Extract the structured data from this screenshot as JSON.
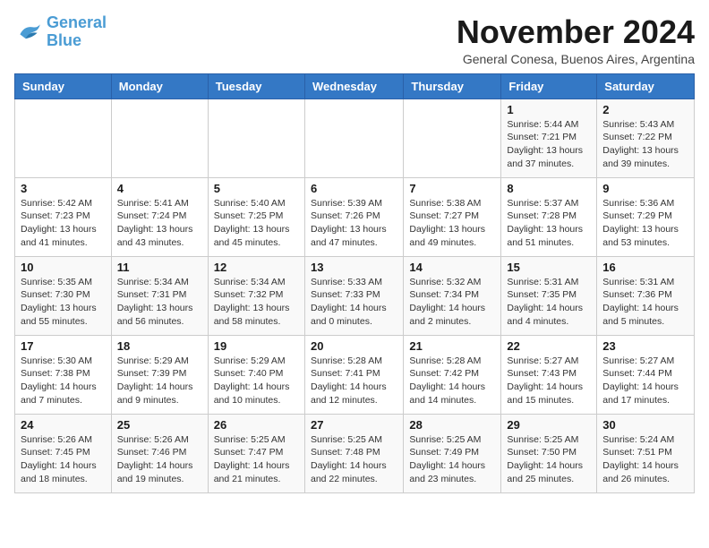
{
  "logo": {
    "line1": "General",
    "line2": "Blue"
  },
  "title": "November 2024",
  "subtitle": "General Conesa, Buenos Aires, Argentina",
  "headers": [
    "Sunday",
    "Monday",
    "Tuesday",
    "Wednesday",
    "Thursday",
    "Friday",
    "Saturday"
  ],
  "weeks": [
    [
      {
        "day": "",
        "info": ""
      },
      {
        "day": "",
        "info": ""
      },
      {
        "day": "",
        "info": ""
      },
      {
        "day": "",
        "info": ""
      },
      {
        "day": "",
        "info": ""
      },
      {
        "day": "1",
        "info": "Sunrise: 5:44 AM\nSunset: 7:21 PM\nDaylight: 13 hours and 37 minutes."
      },
      {
        "day": "2",
        "info": "Sunrise: 5:43 AM\nSunset: 7:22 PM\nDaylight: 13 hours and 39 minutes."
      }
    ],
    [
      {
        "day": "3",
        "info": "Sunrise: 5:42 AM\nSunset: 7:23 PM\nDaylight: 13 hours and 41 minutes."
      },
      {
        "day": "4",
        "info": "Sunrise: 5:41 AM\nSunset: 7:24 PM\nDaylight: 13 hours and 43 minutes."
      },
      {
        "day": "5",
        "info": "Sunrise: 5:40 AM\nSunset: 7:25 PM\nDaylight: 13 hours and 45 minutes."
      },
      {
        "day": "6",
        "info": "Sunrise: 5:39 AM\nSunset: 7:26 PM\nDaylight: 13 hours and 47 minutes."
      },
      {
        "day": "7",
        "info": "Sunrise: 5:38 AM\nSunset: 7:27 PM\nDaylight: 13 hours and 49 minutes."
      },
      {
        "day": "8",
        "info": "Sunrise: 5:37 AM\nSunset: 7:28 PM\nDaylight: 13 hours and 51 minutes."
      },
      {
        "day": "9",
        "info": "Sunrise: 5:36 AM\nSunset: 7:29 PM\nDaylight: 13 hours and 53 minutes."
      }
    ],
    [
      {
        "day": "10",
        "info": "Sunrise: 5:35 AM\nSunset: 7:30 PM\nDaylight: 13 hours and 55 minutes."
      },
      {
        "day": "11",
        "info": "Sunrise: 5:34 AM\nSunset: 7:31 PM\nDaylight: 13 hours and 56 minutes."
      },
      {
        "day": "12",
        "info": "Sunrise: 5:34 AM\nSunset: 7:32 PM\nDaylight: 13 hours and 58 minutes."
      },
      {
        "day": "13",
        "info": "Sunrise: 5:33 AM\nSunset: 7:33 PM\nDaylight: 14 hours and 0 minutes."
      },
      {
        "day": "14",
        "info": "Sunrise: 5:32 AM\nSunset: 7:34 PM\nDaylight: 14 hours and 2 minutes."
      },
      {
        "day": "15",
        "info": "Sunrise: 5:31 AM\nSunset: 7:35 PM\nDaylight: 14 hours and 4 minutes."
      },
      {
        "day": "16",
        "info": "Sunrise: 5:31 AM\nSunset: 7:36 PM\nDaylight: 14 hours and 5 minutes."
      }
    ],
    [
      {
        "day": "17",
        "info": "Sunrise: 5:30 AM\nSunset: 7:38 PM\nDaylight: 14 hours and 7 minutes."
      },
      {
        "day": "18",
        "info": "Sunrise: 5:29 AM\nSunset: 7:39 PM\nDaylight: 14 hours and 9 minutes."
      },
      {
        "day": "19",
        "info": "Sunrise: 5:29 AM\nSunset: 7:40 PM\nDaylight: 14 hours and 10 minutes."
      },
      {
        "day": "20",
        "info": "Sunrise: 5:28 AM\nSunset: 7:41 PM\nDaylight: 14 hours and 12 minutes."
      },
      {
        "day": "21",
        "info": "Sunrise: 5:28 AM\nSunset: 7:42 PM\nDaylight: 14 hours and 14 minutes."
      },
      {
        "day": "22",
        "info": "Sunrise: 5:27 AM\nSunset: 7:43 PM\nDaylight: 14 hours and 15 minutes."
      },
      {
        "day": "23",
        "info": "Sunrise: 5:27 AM\nSunset: 7:44 PM\nDaylight: 14 hours and 17 minutes."
      }
    ],
    [
      {
        "day": "24",
        "info": "Sunrise: 5:26 AM\nSunset: 7:45 PM\nDaylight: 14 hours and 18 minutes."
      },
      {
        "day": "25",
        "info": "Sunrise: 5:26 AM\nSunset: 7:46 PM\nDaylight: 14 hours and 19 minutes."
      },
      {
        "day": "26",
        "info": "Sunrise: 5:25 AM\nSunset: 7:47 PM\nDaylight: 14 hours and 21 minutes."
      },
      {
        "day": "27",
        "info": "Sunrise: 5:25 AM\nSunset: 7:48 PM\nDaylight: 14 hours and 22 minutes."
      },
      {
        "day": "28",
        "info": "Sunrise: 5:25 AM\nSunset: 7:49 PM\nDaylight: 14 hours and 23 minutes."
      },
      {
        "day": "29",
        "info": "Sunrise: 5:25 AM\nSunset: 7:50 PM\nDaylight: 14 hours and 25 minutes."
      },
      {
        "day": "30",
        "info": "Sunrise: 5:24 AM\nSunset: 7:51 PM\nDaylight: 14 hours and 26 minutes."
      }
    ]
  ]
}
